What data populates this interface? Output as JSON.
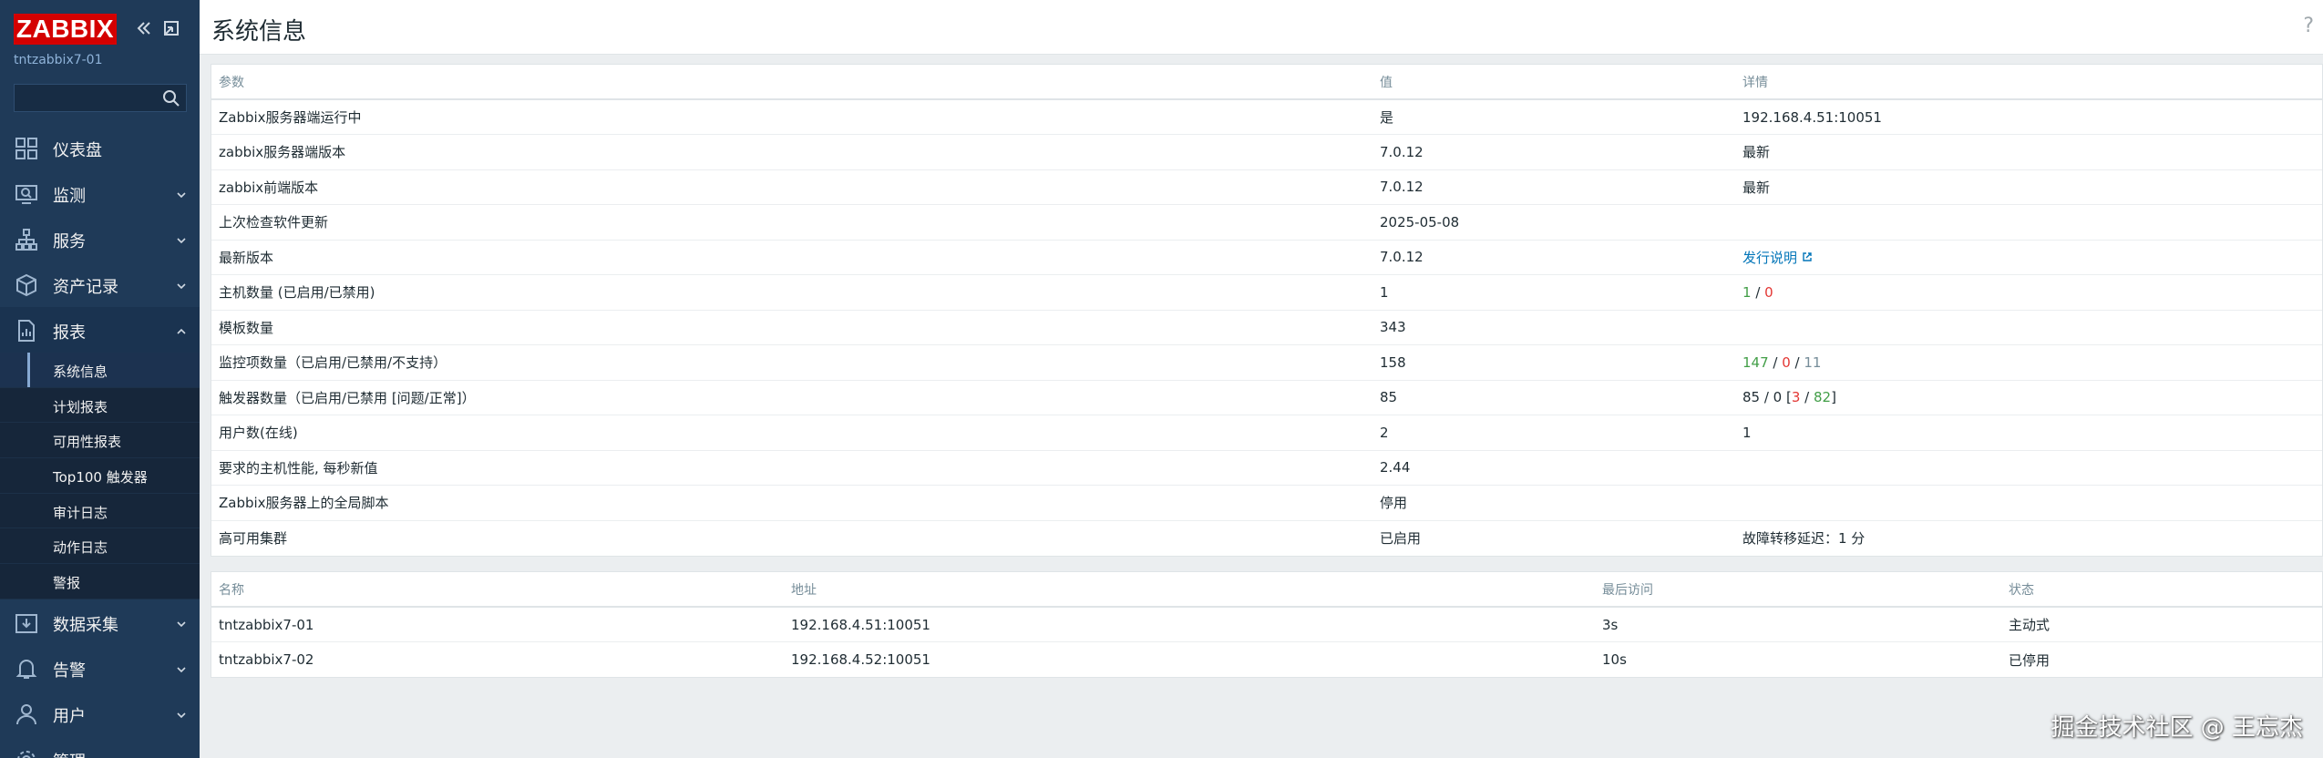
{
  "app": {
    "logo": "ZABBIX",
    "server_name": "tntzabbix7-01"
  },
  "search": {
    "placeholder": ""
  },
  "menu": [
    {
      "label": "仪表盘",
      "icon": "dashboard-icon",
      "has_chevron": false
    },
    {
      "label": "监测",
      "icon": "monitoring-icon",
      "has_chevron": true
    },
    {
      "label": "服务",
      "icon": "services-icon",
      "has_chevron": true
    },
    {
      "label": "资产记录",
      "icon": "inventory-icon",
      "has_chevron": true
    },
    {
      "label": "报表",
      "icon": "reports-icon",
      "has_chevron": true
    }
  ],
  "reports_submenu": [
    "系统信息",
    "计划报表",
    "可用性报表",
    "Top100 触发器",
    "审计日志",
    "动作日志",
    "警报"
  ],
  "menu_bottom": [
    {
      "label": "数据采集",
      "icon": "data-collection-icon"
    },
    {
      "label": "告警",
      "icon": "alerts-icon"
    },
    {
      "label": "用户",
      "icon": "users-icon"
    },
    {
      "label": "管理",
      "icon": "administration-icon"
    }
  ],
  "page": {
    "title": "系统信息",
    "help": "?"
  },
  "info_table": {
    "headers": [
      "参数",
      "值",
      "详情"
    ],
    "rows": [
      {
        "param": "Zabbix服务器端运行中",
        "value": "是",
        "details": "192.168.4.51:10051"
      },
      {
        "param": "zabbix服务器端版本",
        "value": "7.0.12",
        "details": "最新"
      },
      {
        "param": "zabbix前端版本",
        "value": "7.0.12",
        "details": "最新"
      },
      {
        "param": "上次检查软件更新",
        "value": "2025-05-08",
        "details": ""
      },
      {
        "param": "最新版本",
        "value": "7.0.12",
        "details": "发行说明"
      },
      {
        "param": "主机数量 (已启用/已禁用)",
        "value": "1",
        "d1": "1",
        "d2": "0"
      },
      {
        "param": "模板数量",
        "value": "343",
        "details": ""
      },
      {
        "param": "监控项数量（已启用/已禁用/不支持）",
        "value": "158",
        "d1": "147",
        "d2": "0",
        "d3": "11"
      },
      {
        "param": "触发器数量（已启用/已禁用 [问题/正常]）",
        "value": "85",
        "d1": "85 / 0 [",
        "d2": "3",
        "d3": "82",
        "d4": "]"
      },
      {
        "param": "用户数(在线)",
        "value": "2",
        "details": "1"
      },
      {
        "param": "要求的主机性能, 每秒新值",
        "value": "2.44",
        "details": ""
      },
      {
        "param": "Zabbix服务器上的全局脚本",
        "value": "停用",
        "details": ""
      },
      {
        "param": "高可用集群",
        "value": "已启用",
        "details": "故障转移延迟：1 分"
      }
    ]
  },
  "ha_table": {
    "headers": [
      "名称",
      "地址",
      "最后访问",
      "状态"
    ],
    "rows": [
      {
        "name": "tntzabbix7-01",
        "address": "192.168.4.51:10051",
        "last_access": "3s",
        "status": "主动式"
      },
      {
        "name": "tntzabbix7-02",
        "address": "192.168.4.52:10051",
        "last_access": "10s",
        "status": "已停用"
      }
    ]
  },
  "watermark": "掘金技术社区 @ 王忘杰",
  "colors": {
    "sidebar": "#1f3a58",
    "logo": "#d40000",
    "green": "#429e47",
    "red": "#e33734",
    "link": "#0275b8"
  }
}
